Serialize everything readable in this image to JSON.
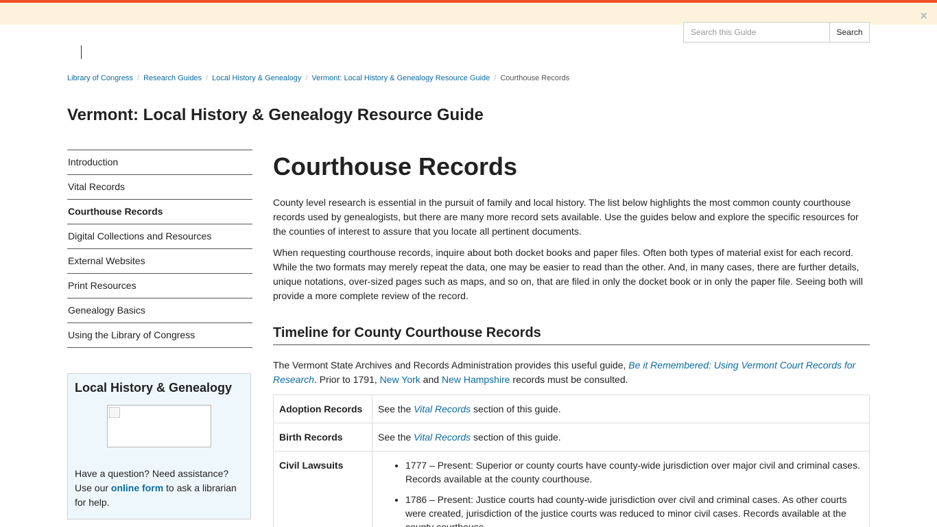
{
  "alert": {
    "close_glyph": "×"
  },
  "search": {
    "placeholder": "Search this Guide",
    "button_label": "Search"
  },
  "breadcrumb": [
    {
      "label": "Library of Congress"
    },
    {
      "label": "Research Guides"
    },
    {
      "label": "Local History & Genealogy"
    },
    {
      "label": "Vermont: Local History & Genealogy Resource Guide"
    },
    {
      "label": "Courthouse Records"
    }
  ],
  "breadcrumb_separator": "/",
  "guide_title": "Vermont: Local History & Genealogy Resource Guide",
  "sidebar": {
    "items": [
      {
        "label": "Introduction"
      },
      {
        "label": "Vital Records"
      },
      {
        "label": "Courthouse Records",
        "active": true
      },
      {
        "label": "Digital Collections and Resources"
      },
      {
        "label": "External Websites"
      },
      {
        "label": "Print Resources"
      },
      {
        "label": "Genealogy Basics"
      },
      {
        "label": "Using the Library of Congress"
      }
    ]
  },
  "help_box": {
    "title": "Local History & Genealogy",
    "text_before": "Have a question? Need assistance? Use our ",
    "link_label": "online form",
    "text_after": " to ask a librarian for help."
  },
  "main": {
    "title": "Courthouse Records",
    "paragraphs": [
      "County level research is essential in the pursuit of family and local history. The list below highlights the most common county courthouse records used by genealogists, but there are many more record sets available. Use the guides below and explore the specific resources for the counties of interest to assure that you locate all pertinent documents.",
      "When requesting courthouse records, inquire about both docket books and paper files. Often both types of material exist for each record. While the two formats may merely repeat the data, one may be easier to read than the other. And, in many cases, there are further details, unique notations, over-sized pages such as maps, and so on, that are filed in only the docket book or in only the paper file. Seeing both will provide a more complete review of the record."
    ],
    "section": {
      "title": "Timeline for County Courthouse Records",
      "intro_prefix": "The Vermont State Archives and Records Administration provides this useful guide, ",
      "intro_link": "Be it Remembered: Using Vermont Court Records for Research",
      "intro_mid1": ". Prior to 1791, ",
      "link_ny": "New York",
      "intro_and": " and ",
      "link_nh": "New Hampshire",
      "intro_suffix": " records must be consulted."
    },
    "table": {
      "rows": [
        {
          "label": "Adoption Records",
          "pre": "See the ",
          "link": "Vital Records",
          "post": " section of this guide."
        },
        {
          "label": "Birth Records",
          "pre": "See the ",
          "link": "Vital Records",
          "post": " section of this guide."
        },
        {
          "label": "Civil Lawsuits",
          "bullets": [
            "1777 – Present: Superior or county courts have county-wide jurisdiction over major civil and criminal cases. Records available at the county courthouse.",
            "1786 – Present: Justice courts had county-wide jurisdiction over civil and criminal cases. As other courts were created, jurisdiction of the justice courts was reduced to minor civil cases. Records available at the county courthouse."
          ]
        }
      ]
    }
  }
}
